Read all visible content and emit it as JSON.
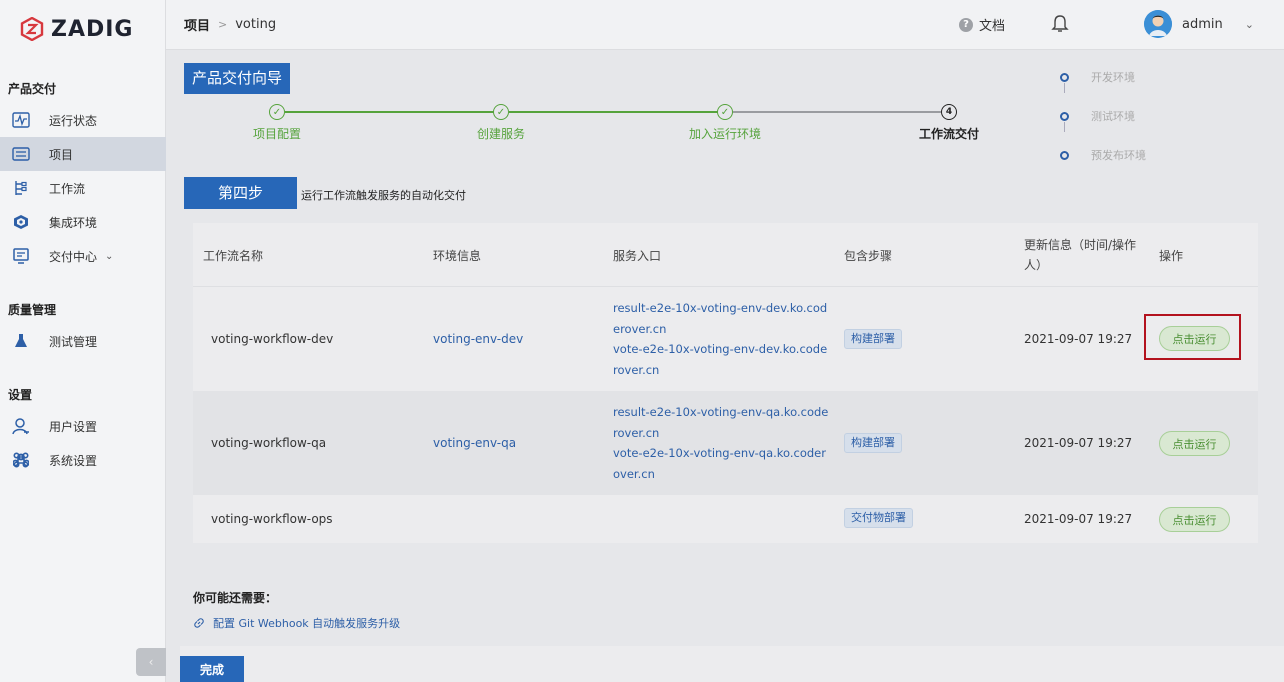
{
  "sidebar": {
    "logo_text": "ZADIG",
    "groups": [
      {
        "label": "产品交付"
      },
      {
        "label": "质量管理"
      },
      {
        "label": "设置"
      }
    ],
    "items": [
      {
        "label": "运行状态",
        "icon": "pulse-icon"
      },
      {
        "label": "项目",
        "icon": "project-icon"
      },
      {
        "label": "工作流",
        "icon": "workflow-icon"
      },
      {
        "label": "集成环境",
        "icon": "cube-icon"
      },
      {
        "label": "交付中心",
        "icon": "delivery-icon"
      },
      {
        "label": "测试管理",
        "icon": "flask-icon"
      },
      {
        "label": "用户设置",
        "icon": "user-icon"
      },
      {
        "label": "系统设置",
        "icon": "command-icon"
      }
    ],
    "active_item": "项目"
  },
  "header": {
    "breadcrumb_root": "项目",
    "breadcrumb_sep": ">",
    "breadcrumb_current": "voting",
    "doc_label": "文档",
    "username": "admin"
  },
  "guide": {
    "title": "产品交付向导",
    "steps": [
      {
        "label": "项目配置",
        "status": "done"
      },
      {
        "label": "创建服务",
        "status": "done"
      },
      {
        "label": "加入运行环境",
        "status": "done"
      },
      {
        "label": "工作流交付",
        "status": "current",
        "number": "4"
      }
    ],
    "environments": [
      "开发环境",
      "测试环境",
      "预发布环境"
    ],
    "step_four_title": "第四步",
    "step_four_desc": "运行工作流触发服务的自动化交付"
  },
  "table": {
    "headers": {
      "name": "工作流名称",
      "env": "环境信息",
      "entry": "服务入口",
      "steps": "包含步骤",
      "updated": "更新信息（时间/操作人）",
      "action": "操作"
    },
    "rows": [
      {
        "name": "voting-workflow-dev",
        "env": "voting-env-dev",
        "entries": [
          "result-e2e-10x-voting-env-dev.ko.coderover.cn",
          "vote-e2e-10x-voting-env-dev.ko.coderover.cn"
        ],
        "tag": "构建部署",
        "updated": "2021-09-07 19:27",
        "action": "点击运行"
      },
      {
        "name": "voting-workflow-qa",
        "env": "voting-env-qa",
        "entries": [
          "result-e2e-10x-voting-env-qa.ko.coderover.cn",
          "vote-e2e-10x-voting-env-qa.ko.coderover.cn"
        ],
        "tag": "构建部署",
        "updated": "2021-09-07 19:27",
        "action": "点击运行"
      },
      {
        "name": "voting-workflow-ops",
        "env": "",
        "entries": [],
        "tag": "交付物部署",
        "updated": "2021-09-07 19:27",
        "action": "点击运行"
      }
    ]
  },
  "footer": {
    "maybe_title": "你可能还需要：",
    "webhook_link": "配置 Git Webhook 自动触发服务升级",
    "done_label": "完成"
  },
  "colors": {
    "primary": "#2767b8",
    "success": "#56a33c",
    "link": "#2d5fa7",
    "highlight": "#b3121e"
  }
}
